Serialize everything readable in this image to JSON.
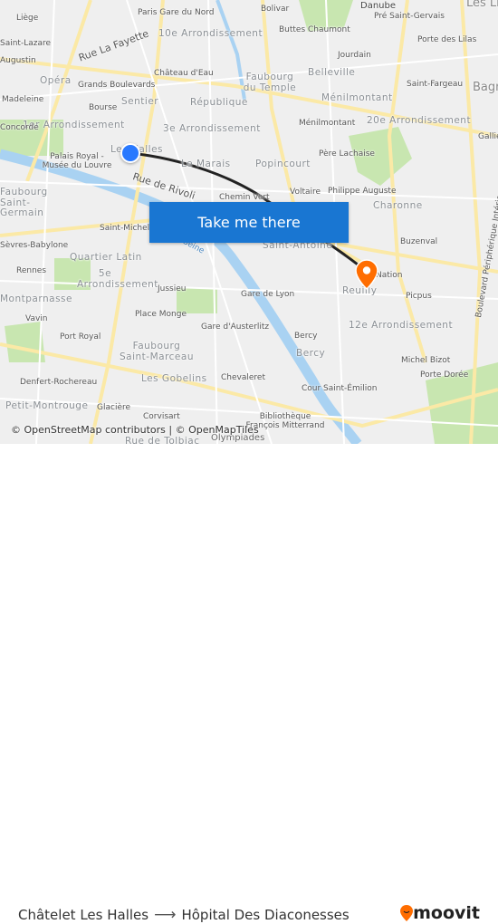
{
  "map": {
    "labels": [
      "Liège",
      "Paris Gare du Nord",
      "10e Arrondissement",
      "Rue La Fayette",
      "Saint-Lazare",
      "Augustin",
      "Château d'Eau",
      "Opéra",
      "Grands Boulevards",
      "Madeleine",
      "Sentier",
      "Bourse",
      "République",
      "1er Arrondissement",
      "Concorde",
      "3e Arrondissement",
      "Palais Royal - Musée du Louvre",
      "Les Halles",
      "Le Marais",
      "Rue de Rivoli",
      "Faubourg Saint-Germain",
      "Chemin Vert",
      "Bolivar",
      "Buttes Chaumont",
      "Danube",
      "Pré Saint-Gervais",
      "Les Lilas",
      "Jourdain",
      "Porte des Lilas",
      "Belleville",
      "Faubourg du Temple",
      "Ménilmontant",
      "Saint-Fargeau",
      "Bagnolet",
      "Ménilmontant",
      "20e Arrondissement",
      "Gallieni",
      "Popincourt",
      "Père Lachaise",
      "Voltaire",
      "Philippe Auguste",
      "Charonne",
      "Boulevard Périphérique Intérieur",
      "Saint-Michel Notre-Dame",
      "Sèvres-Babylone",
      "La Seine",
      "Saint-Antoine",
      "Buzenval",
      "Quartier Latin",
      "Rennes",
      "5e Arrondissement",
      "Jussieu",
      "Nation",
      "Reuilly",
      "Picpus",
      "Gare de Lyon",
      "Montparnasse",
      "Vavin",
      "Place Monge",
      "Gare d'Austerlitz",
      "12e Arrondissement",
      "Port Royal",
      "Faubourg Saint-Marceau",
      "Bercy",
      "Bercy",
      "Michel Bizot",
      "Denfert-Rochereau",
      "Les Gobelins",
      "Chevaleret",
      "Porte Dorée",
      "Cour Saint-Émilion",
      "Petit-Montrouge",
      "Glacière",
      "Corvisart",
      "Bibliothèque François Mitterrand",
      "Rue de Tolbiac",
      "Olympiades"
    ],
    "button_label": "Take me there",
    "attribution": "© OpenStreetMap contributors | © OpenMapTiles",
    "origin_marker_color": "#2979ff",
    "destination_marker_color": "#ff6d00",
    "route_color": "#222222"
  },
  "footer": {
    "origin": "Châtelet Les Halles",
    "arrow": "⟶",
    "destination": "Hôpital Des Diaconesses",
    "logo_text": "moovit",
    "logo_color": "#ff6d00"
  }
}
